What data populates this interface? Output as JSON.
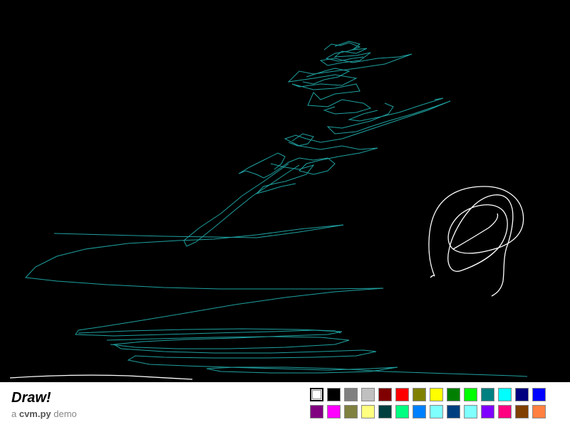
{
  "app": {
    "title": "Draw!",
    "subtitle_prefix": "a ",
    "subtitle_bold": "cvm.py",
    "subtitle_suffix": " demo"
  },
  "palette": {
    "selected_index": 0,
    "colors": [
      "#ffffff",
      "#000000",
      "#808080",
      "#c0c0c0",
      "#800000",
      "#ff0000",
      "#808000",
      "#ffff00",
      "#008000",
      "#00ff00",
      "#008080",
      "#00ffff",
      "#000080",
      "#0000ff",
      "#800080",
      "#ff00ff",
      "#808040",
      "#ffff80",
      "#004040",
      "#00ff80",
      "#0080ff",
      "#80ffff",
      "#004080",
      "#80ffff",
      "#8000ff",
      "#ff0080",
      "#804000",
      "#ff8040"
    ]
  },
  "strokes": {
    "teal_color": "#1fa0a0",
    "white_color": "#ffffff"
  }
}
